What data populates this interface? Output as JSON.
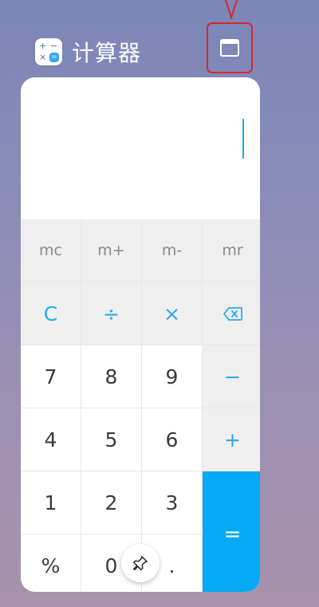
{
  "app": {
    "title": "计算器",
    "icon_glyphs": {
      "plus": "+",
      "minus": "−",
      "times": "×",
      "equals": "="
    }
  },
  "header_controls": {
    "window_button_icon": "window-mode-icon"
  },
  "display": {
    "value": ""
  },
  "keypad": {
    "memory": [
      "mc",
      "m+",
      "m-",
      "mr"
    ],
    "row_ops": {
      "clear": "C",
      "divide": "÷",
      "multiply": "×",
      "backspace_icon": "backspace-icon"
    },
    "row_789": [
      "7",
      "8",
      "9"
    ],
    "minus": "−",
    "row_456": [
      "4",
      "5",
      "6"
    ],
    "plus": "+",
    "row_123": [
      "1",
      "2",
      "3"
    ],
    "equals": "=",
    "percent": "%",
    "zero": "0",
    "decimal": "."
  },
  "floating": {
    "pin_icon": "pin-icon"
  },
  "colors": {
    "accent": "#2aa8f0",
    "equals_bg": "#06a9f4",
    "annotation_red": "#d8262e"
  }
}
